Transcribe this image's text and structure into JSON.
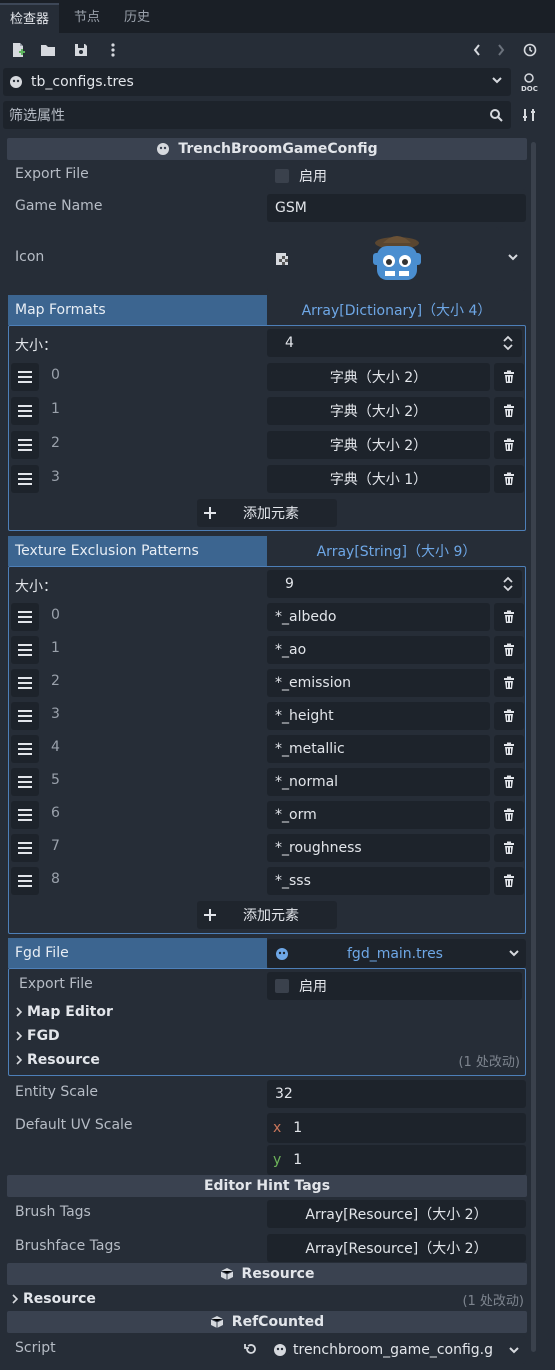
{
  "tabs": [
    {
      "label": "检查器"
    },
    {
      "label": "节点"
    },
    {
      "label": "历史"
    }
  ],
  "resource_path": "tb_configs.tres",
  "filter_placeholder": "筛选属性",
  "header_class": "TrenchBroomGameConfig",
  "export_file": {
    "label": "Export File",
    "checkbox_label": "启用"
  },
  "game_name": {
    "label": "Game Name",
    "value": "GSM"
  },
  "icon": {
    "label": "Icon"
  },
  "map_formats": {
    "label": "Map Formats",
    "type": "Array[Dictionary]（大小 4）",
    "size_label": "大小：",
    "size": "4",
    "items": [
      {
        "index": "0",
        "value": "字典（大小 2）"
      },
      {
        "index": "1",
        "value": "字典（大小 2）"
      },
      {
        "index": "2",
        "value": "字典（大小 2）"
      },
      {
        "index": "3",
        "value": "字典（大小 1）"
      }
    ],
    "add_label": "添加元素"
  },
  "texture_exclusion": {
    "label": "Texture Exclusion Patterns",
    "type": "Array[String]（大小 9）",
    "size_label": "大小：",
    "size": "9",
    "items": [
      {
        "index": "0",
        "value": "*_albedo"
      },
      {
        "index": "1",
        "value": "*_ao"
      },
      {
        "index": "2",
        "value": "*_emission"
      },
      {
        "index": "3",
        "value": "*_height"
      },
      {
        "index": "4",
        "value": "*_metallic"
      },
      {
        "index": "5",
        "value": "*_normal"
      },
      {
        "index": "6",
        "value": "*_orm"
      },
      {
        "index": "7",
        "value": "*_roughness"
      },
      {
        "index": "8",
        "value": "*_sss"
      }
    ],
    "add_label": "添加元素"
  },
  "fgd_file": {
    "label": "Fgd File",
    "value": "fgd_main.tres",
    "export_file_label": "Export File",
    "checkbox_label": "启用",
    "groups": [
      {
        "label": "Map Editor",
        "note": ""
      },
      {
        "label": "FGD",
        "note": ""
      },
      {
        "label": "Resource",
        "note": "(1 处改动)"
      }
    ]
  },
  "entity_scale": {
    "label": "Entity Scale",
    "value": "32"
  },
  "default_uv_scale": {
    "label": "Default UV Scale",
    "x_label": "x",
    "x": "1",
    "y_label": "y",
    "y": "1"
  },
  "editor_hint_tags": {
    "header": "Editor Hint Tags",
    "brush_tags_label": "Brush Tags",
    "brush_tags_value": "Array[Resource]（大小 2）",
    "brushface_tags_label": "Brushface Tags",
    "brushface_tags_value": "Array[Resource]（大小 2）"
  },
  "resource_section": {
    "header": "Resource",
    "group_label": "Resource",
    "note": "(1 处改动)"
  },
  "refcounted": {
    "header": "RefCounted",
    "script_label": "Script",
    "script_value": "trenchbroom_game_config.gd"
  },
  "colors": {
    "accent": "#3c6590",
    "link": "#6ea7e6",
    "border": "#4d7fb8",
    "x_axis": "#c8755a",
    "y_axis": "#6db35a"
  }
}
